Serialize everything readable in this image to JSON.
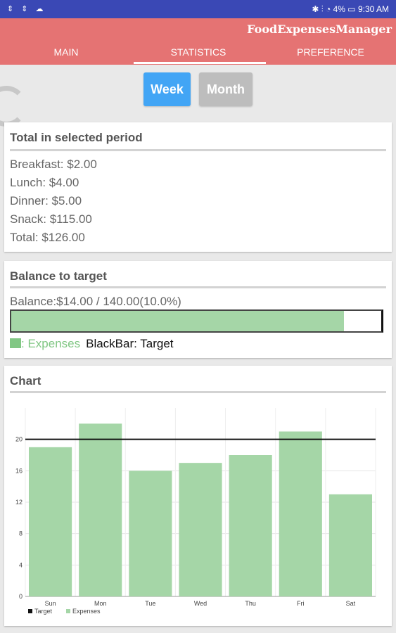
{
  "status_bar": {
    "left_icons": "⇕ ⇕ ☁",
    "right_text": "✱ ⫶ ◔ 4% ▭ 9:30 AM"
  },
  "app": {
    "title": "FoodExpensesManager",
    "tabs": [
      "MAIN",
      "STATISTICS",
      "PREFERENCE"
    ],
    "active_tab": "STATISTICS"
  },
  "period": {
    "week_label": "Week",
    "month_label": "Month",
    "selected": "Week"
  },
  "total_card": {
    "title": "Total in selected period",
    "lines": [
      "Breakfast: $2.00",
      "Lunch: $4.00",
      "Dinner: $5.00",
      "Snack: $115.00",
      "Total: $126.00"
    ]
  },
  "balance_card": {
    "title": "Balance to target",
    "text": "Balance:$14.00 / 140.00(10.0%)",
    "progress": 0.9,
    "legend_expenses": ": Expenses",
    "legend_target": "BlackBar: Target"
  },
  "chart_card": {
    "title": "Chart"
  },
  "colors": {
    "status_bar": "#3a48b5",
    "app_bar": "#e57373",
    "week_button": "#42a5f5",
    "month_button": "#bdbdbd",
    "bar": "#a5d6a7",
    "legend_green": "#81c784"
  },
  "chart_data": {
    "type": "bar",
    "categories": [
      "Sun",
      "Mon",
      "Tue",
      "Wed",
      "Thu",
      "Fri",
      "Sat"
    ],
    "series": [
      {
        "name": "Expenses",
        "values": [
          19,
          22,
          16,
          17,
          18,
          21,
          13
        ]
      }
    ],
    "target": 20,
    "ylim": [
      0,
      24
    ],
    "yticks": [
      0,
      4,
      8,
      12,
      16,
      20
    ],
    "legend": [
      "Target",
      "Expenses"
    ],
    "legend_position": "bottom-left",
    "grid": true
  }
}
